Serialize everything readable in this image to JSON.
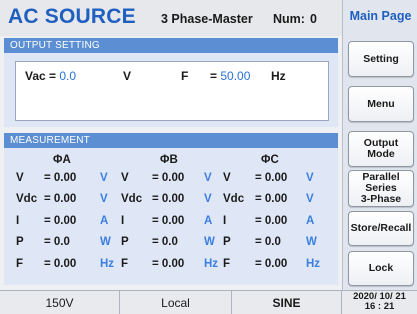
{
  "header": {
    "title": "AC SOURCE",
    "mode": "3 Phase-Master",
    "num_label": "Num:",
    "num_value": "0"
  },
  "sidebar": {
    "page_label": "Main Page",
    "buttons": [
      {
        "label": "Setting"
      },
      {
        "label": "Menu"
      },
      {
        "label": "Output\nMode"
      },
      {
        "label": "Parallel\nSeries\n3-Phase"
      },
      {
        "label": "Store/Recall"
      },
      {
        "label": "Lock"
      }
    ]
  },
  "output_setting": {
    "title": "OUTPUT SETTING",
    "vac_label": "Vac =",
    "vac_value": "0.0",
    "vac_unit": "V",
    "f_label": "F",
    "f_eq": "=",
    "f_value": "50.00",
    "f_unit": "Hz"
  },
  "measurement": {
    "title": "MEASUREMENT",
    "phases": [
      "ΦA",
      "ΦB",
      "ΦC"
    ],
    "rows": [
      {
        "label": "V",
        "a": "= 0.00",
        "b": "= 0.00",
        "c": "= 0.00",
        "unit": "V"
      },
      {
        "label": "Vdc",
        "a": "= 0.00",
        "b": "= 0.00",
        "c": "= 0.00",
        "unit": "V"
      },
      {
        "label": "I",
        "a": "= 0.00",
        "b": "= 0.00",
        "c": "= 0.00",
        "unit": "A"
      },
      {
        "label": "P",
        "a": "= 0.0",
        "b": "= 0.0",
        "c": "= 0.0",
        "unit": "W"
      },
      {
        "label": "F",
        "a": "= 0.00",
        "b": "= 0.00",
        "c": "= 0.00",
        "unit": "Hz"
      }
    ]
  },
  "status_bar": {
    "voltage_range": "150V",
    "control": "Local",
    "waveform": "SINE",
    "datetime": "2020/ 10/ 21\n16 : 21"
  }
}
